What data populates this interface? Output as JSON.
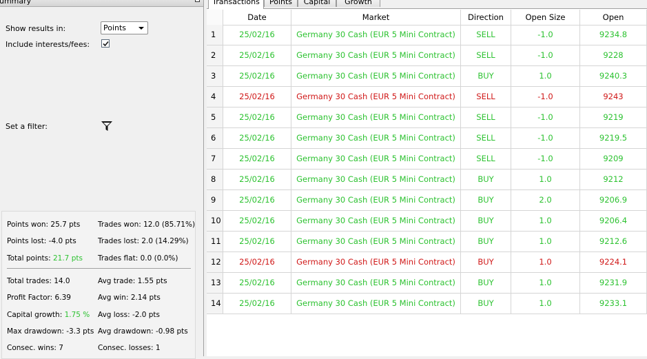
{
  "summary": {
    "title": "ummary",
    "show_results_label": "Show results in:",
    "show_results_value": "Points",
    "include_fees_label": "Include interests/fees:",
    "include_fees_checked": true,
    "filter_label": "Set a filter:",
    "filter_icon": "funnel-icon",
    "stats": {
      "points_won": "Points won: 25.7 pts",
      "trades_won": "Trades won: 12.0 (85.71%)",
      "points_lost": "Points lost: -4.0 pts",
      "trades_lost": "Trades lost: 2.0 (14.29%)",
      "total_points_label": "Total points: ",
      "total_points_value": "21.7 pts",
      "trades_flat": "Trades flat: 0.0 (0.0%)",
      "total_trades": "Total trades: 14.0",
      "avg_trade": "Avg trade: 1.55 pts",
      "profit_factor": "Profit Factor: 6.39",
      "avg_win": "Avg win: 2.14 pts",
      "capital_growth_label": "Capital growth: ",
      "capital_growth_value": "1.75 %",
      "avg_loss": "Avg loss: -2.0 pts",
      "max_drawdown": "Max drawdown: -3.3 pts",
      "avg_drawdown": "Avg drawdown: -0.98 pts",
      "consec_wins": "Consec. wins: 7",
      "consec_losses": "Consec. losses: 1"
    }
  },
  "tabs": [
    "Transactions",
    "Points",
    "Capital",
    "Growth"
  ],
  "table": {
    "columns": [
      "Date",
      "Market",
      "Direction",
      "Open Size",
      "Open"
    ],
    "rows": [
      {
        "n": "1",
        "date": "25/02/16",
        "market": "Germany 30 Cash (EUR 5 Mini Contract)",
        "direction": "SELL",
        "size": "-1.0",
        "open": "9234.8",
        "result": "win"
      },
      {
        "n": "2",
        "date": "25/02/16",
        "market": "Germany 30 Cash (EUR 5 Mini Contract)",
        "direction": "SELL",
        "size": "-1.0",
        "open": "9228",
        "result": "win"
      },
      {
        "n": "3",
        "date": "25/02/16",
        "market": "Germany 30 Cash (EUR 5 Mini Contract)",
        "direction": "BUY",
        "size": "1.0",
        "open": "9240.3",
        "result": "win"
      },
      {
        "n": "4",
        "date": "25/02/16",
        "market": "Germany 30 Cash (EUR 5 Mini Contract)",
        "direction": "SELL",
        "size": "-1.0",
        "open": "9243",
        "result": "loss"
      },
      {
        "n": "5",
        "date": "25/02/16",
        "market": "Germany 30 Cash (EUR 5 Mini Contract)",
        "direction": "SELL",
        "size": "-1.0",
        "open": "9219",
        "result": "win"
      },
      {
        "n": "6",
        "date": "25/02/16",
        "market": "Germany 30 Cash (EUR 5 Mini Contract)",
        "direction": "SELL",
        "size": "-1.0",
        "open": "9219.5",
        "result": "win"
      },
      {
        "n": "7",
        "date": "25/02/16",
        "market": "Germany 30 Cash (EUR 5 Mini Contract)",
        "direction": "SELL",
        "size": "-1.0",
        "open": "9209",
        "result": "win"
      },
      {
        "n": "8",
        "date": "25/02/16",
        "market": "Germany 30 Cash (EUR 5 Mini Contract)",
        "direction": "BUY",
        "size": "1.0",
        "open": "9212",
        "result": "win"
      },
      {
        "n": "9",
        "date": "25/02/16",
        "market": "Germany 30 Cash (EUR 5 Mini Contract)",
        "direction": "BUY",
        "size": "2.0",
        "open": "9206.9",
        "result": "win"
      },
      {
        "n": "10",
        "date": "25/02/16",
        "market": "Germany 30 Cash (EUR 5 Mini Contract)",
        "direction": "BUY",
        "size": "1.0",
        "open": "9206.4",
        "result": "win"
      },
      {
        "n": "11",
        "date": "25/02/16",
        "market": "Germany 30 Cash (EUR 5 Mini Contract)",
        "direction": "BUY",
        "size": "1.0",
        "open": "9212.6",
        "result": "win"
      },
      {
        "n": "12",
        "date": "25/02/16",
        "market": "Germany 30 Cash (EUR 5 Mini Contract)",
        "direction": "BUY",
        "size": "1.0",
        "open": "9224.1",
        "result": "loss"
      },
      {
        "n": "13",
        "date": "25/02/16",
        "market": "Germany 30 Cash (EUR 5 Mini Contract)",
        "direction": "BUY",
        "size": "1.0",
        "open": "9231.9",
        "result": "win"
      },
      {
        "n": "14",
        "date": "25/02/16",
        "market": "Germany 30 Cash (EUR 5 Mini Contract)",
        "direction": "BUY",
        "size": "1.0",
        "open": "9233.1",
        "result": "win"
      }
    ]
  },
  "colors": {
    "win": "#2cc230",
    "loss": "#d01818"
  }
}
